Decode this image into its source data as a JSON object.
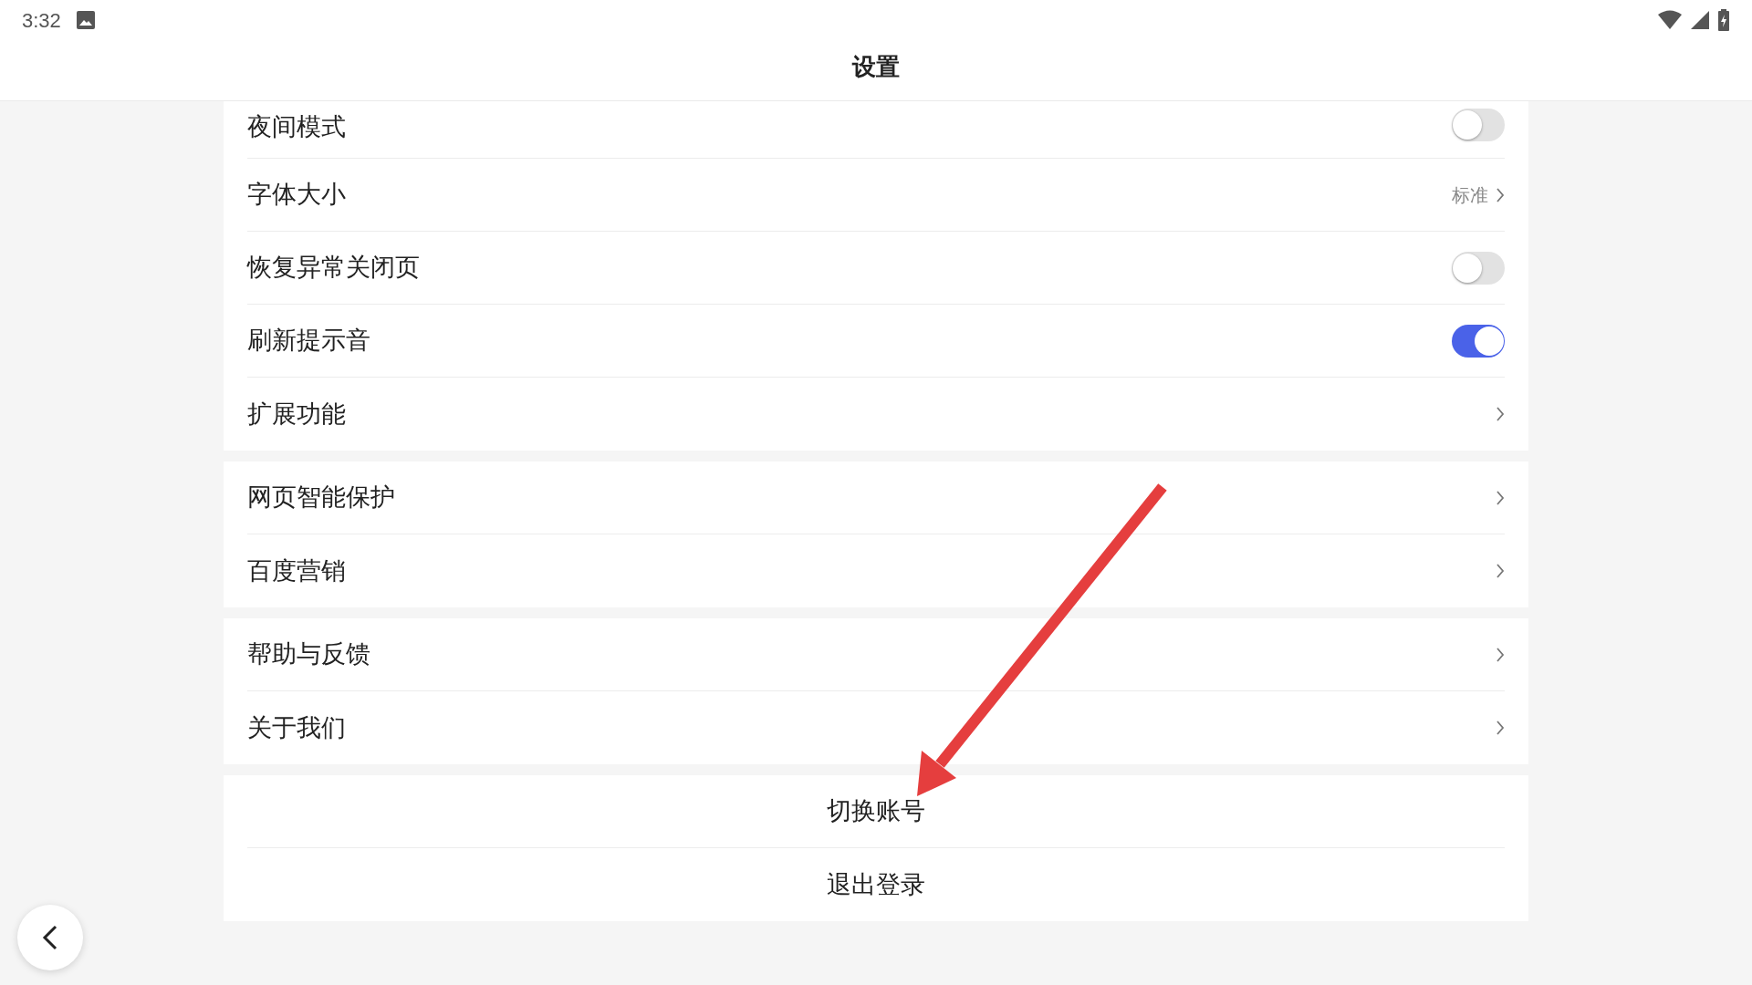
{
  "status_bar": {
    "time": "3:32"
  },
  "title": "设置",
  "groups": [
    {
      "items": [
        {
          "kind": "toggle",
          "label": "夜间模式",
          "on": false
        },
        {
          "kind": "link",
          "label": "字体大小",
          "value": "标准"
        },
        {
          "kind": "toggle",
          "label": "恢复异常关闭页",
          "on": false
        },
        {
          "kind": "toggle",
          "label": "刷新提示音",
          "on": true
        },
        {
          "kind": "link",
          "label": "扩展功能"
        }
      ]
    },
    {
      "items": [
        {
          "kind": "link",
          "label": "网页智能保护"
        },
        {
          "kind": "link",
          "label": "百度营销"
        }
      ]
    },
    {
      "items": [
        {
          "kind": "link",
          "label": "帮助与反馈"
        },
        {
          "kind": "link",
          "label": "关于我们"
        }
      ]
    },
    {
      "items": [
        {
          "kind": "action",
          "label": "切换账号"
        },
        {
          "kind": "action",
          "label": "退出登录"
        }
      ]
    }
  ]
}
